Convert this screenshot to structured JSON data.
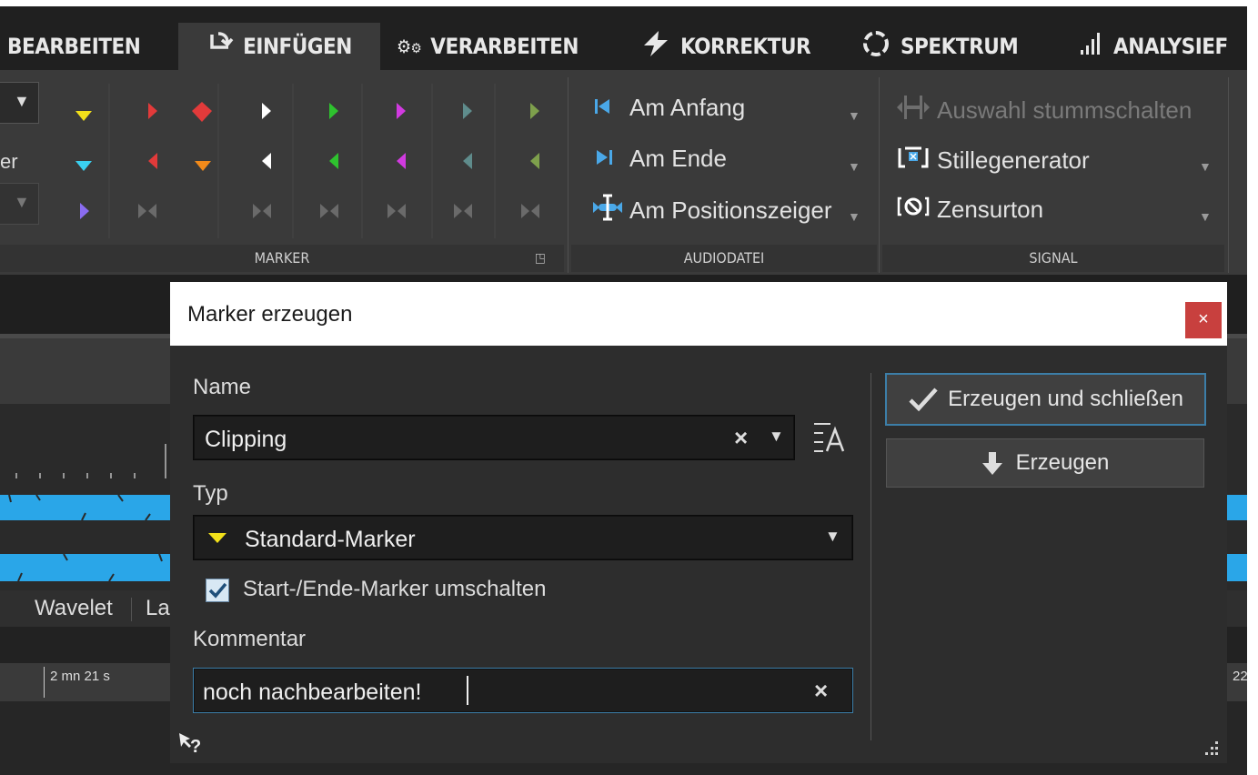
{
  "tabs": [
    {
      "label": "BEARBEITEN",
      "icon": ""
    },
    {
      "label": "EINFÜGEN",
      "icon": "insert-icon"
    },
    {
      "label": "VERARBEITEN",
      "icon": "gears-icon"
    },
    {
      "label": "KORREKTUR",
      "icon": "lightning-icon"
    },
    {
      "label": "SPEKTRUM",
      "icon": "spectrum-icon"
    },
    {
      "label": "ANALYSIEF",
      "icon": "analysis-bars-icon"
    }
  ],
  "ribbon": {
    "marker_group": {
      "label": "MARKER",
      "side_label": "er"
    },
    "audiodatei_group": {
      "label": "AUDIODATEI",
      "items": [
        {
          "label": "Am Anfang",
          "icon": "skip-to-start-icon"
        },
        {
          "label": "Am Ende",
          "icon": "skip-to-end-icon"
        },
        {
          "label": "Am Positionszeiger",
          "icon": "cursor-position-icon"
        }
      ]
    },
    "signal_group": {
      "label": "SIGNAL",
      "items": [
        {
          "label": "Auswahl stummschalten",
          "icon": "mute-selection-icon",
          "disabled": true
        },
        {
          "label": "Stillegenerator",
          "icon": "silence-generator-icon"
        },
        {
          "label": "Zensurton",
          "icon": "censor-tone-icon"
        }
      ]
    }
  },
  "background": {
    "tabs_row": {
      "item1": "Wavelet",
      "item2": "La"
    },
    "ruler": {
      "time": "2 mn 21 s",
      "right_number": "22"
    }
  },
  "dialog": {
    "title": "Marker erzeugen",
    "close": "×",
    "name_label": "Name",
    "name_value": "Clipping",
    "clear_symbol": "×",
    "type_label": "Typ",
    "type_value": "Standard-Marker",
    "toggle_label": "Start-/Ende-Marker umschalten",
    "toggle_checked": true,
    "comment_label": "Kommentar",
    "comment_value": "noch nachbearbeiten!",
    "create_close_button": "Erzeugen und schließen",
    "create_button": "Erzeugen",
    "help_label": "?"
  },
  "colors": {
    "accent": "#3c7ea8",
    "marker_yellow": "#f2e01a",
    "marker_cyan": "#3ad0f0",
    "marker_red": "#e23a3a",
    "marker_orange": "#f28a1a",
    "marker_green": "#2ec22e",
    "marker_magenta": "#d13ae0",
    "marker_purple": "#8a6cf0",
    "waveform": "#2aa6e8",
    "close_red": "#c8403e"
  }
}
